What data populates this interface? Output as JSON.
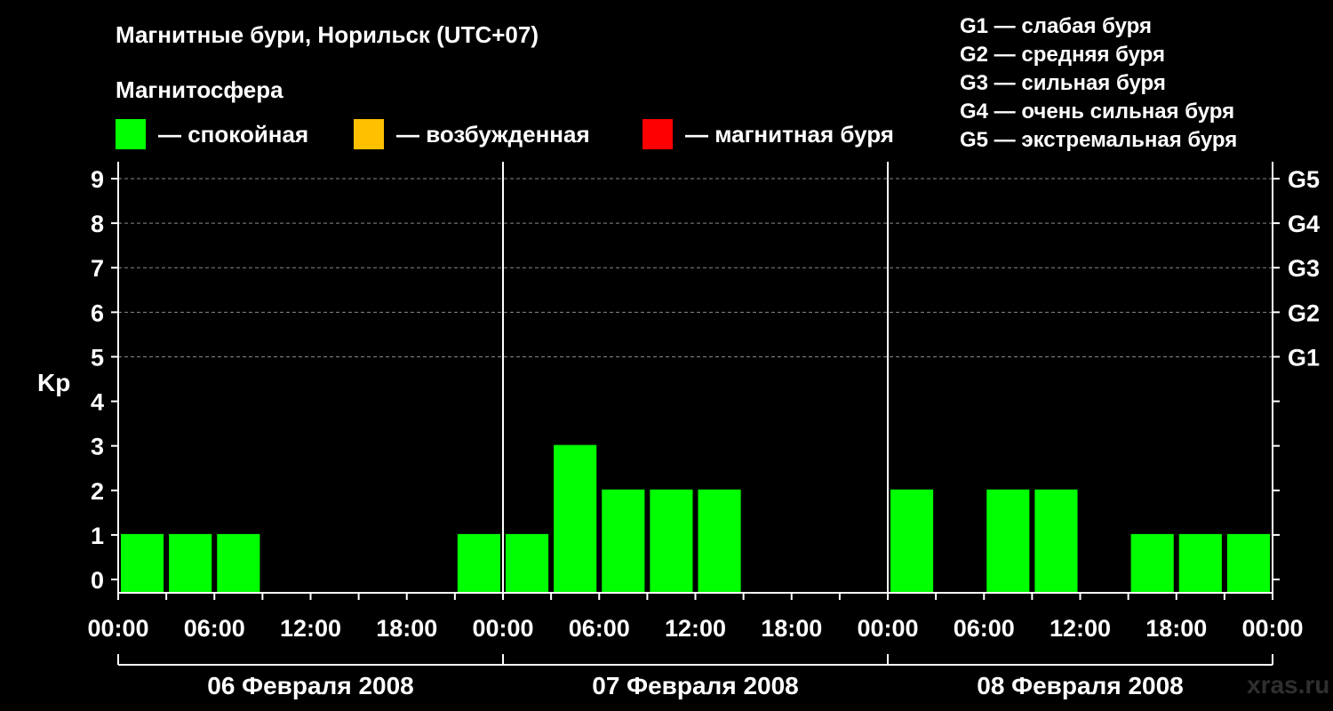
{
  "title": "Магнитные бури, Норильск (UTC+07)",
  "subtitle": "Магнитосфера",
  "legend": [
    {
      "color": "#00ff00",
      "label": "— спокойная"
    },
    {
      "color": "#ffc000",
      "label": "— возбужденная"
    },
    {
      "color": "#ff0000",
      "label": "— магнитная буря"
    }
  ],
  "g_scale": [
    "G1 — слабая буря",
    "G2 — средняя буря",
    "G3 — сильная буря",
    "G4 — очень сильная буря",
    "G5 — экстремальная буря"
  ],
  "watermark": "xras.ru",
  "chart_data": {
    "type": "bar",
    "ylabel": "Kp",
    "ylim": [
      0,
      9
    ],
    "y_ticks": [
      "0",
      "1",
      "2",
      "3",
      "4",
      "5",
      "6",
      "7",
      "8",
      "9"
    ],
    "g_levels": [
      {
        "kp": 5,
        "label": "G1"
      },
      {
        "kp": 6,
        "label": "G2"
      },
      {
        "kp": 7,
        "label": "G3"
      },
      {
        "kp": 8,
        "label": "G4"
      },
      {
        "kp": 9,
        "label": "G5"
      }
    ],
    "x_tick_labels": [
      "00:00",
      "06:00",
      "12:00",
      "18:00",
      "00:00",
      "06:00",
      "12:00",
      "18:00",
      "00:00",
      "06:00",
      "12:00",
      "18:00",
      "00:00"
    ],
    "days": [
      "06 Февраля 2008",
      "07 Февраля 2008",
      "08 Февраля 2008"
    ],
    "grid": "dashed horizontal at Kp 5–9",
    "bar_color": "#00ff00",
    "interval_hours": 3,
    "values": [
      1,
      1,
      1,
      0,
      0,
      0,
      0,
      1,
      1,
      3,
      2,
      2,
      2,
      0,
      0,
      0,
      2,
      0,
      2,
      2,
      0,
      1,
      1,
      1
    ]
  }
}
